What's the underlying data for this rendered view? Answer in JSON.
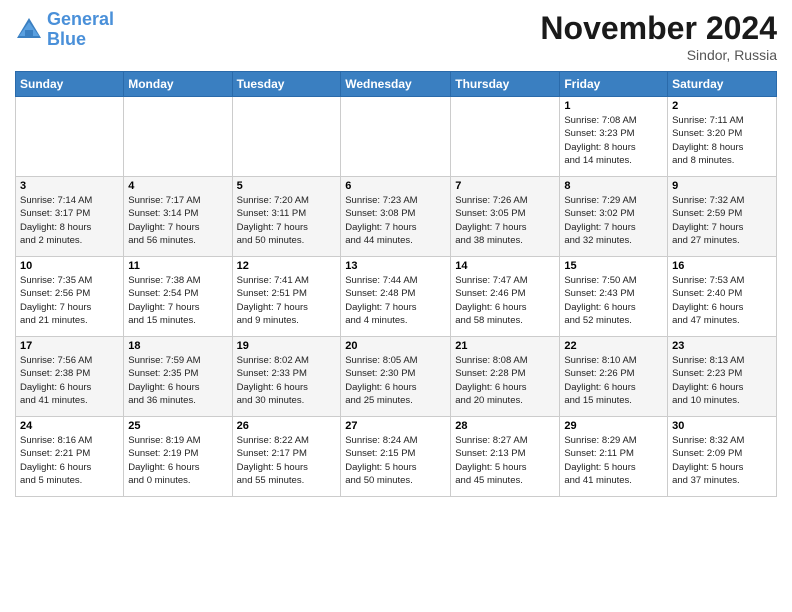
{
  "header": {
    "logo_line1": "General",
    "logo_line2": "Blue",
    "month": "November 2024",
    "location": "Sindor, Russia"
  },
  "days_of_week": [
    "Sunday",
    "Monday",
    "Tuesday",
    "Wednesday",
    "Thursday",
    "Friday",
    "Saturday"
  ],
  "weeks": [
    [
      {
        "day": "",
        "info": ""
      },
      {
        "day": "",
        "info": ""
      },
      {
        "day": "",
        "info": ""
      },
      {
        "day": "",
        "info": ""
      },
      {
        "day": "",
        "info": ""
      },
      {
        "day": "1",
        "info": "Sunrise: 7:08 AM\nSunset: 3:23 PM\nDaylight: 8 hours\nand 14 minutes."
      },
      {
        "day": "2",
        "info": "Sunrise: 7:11 AM\nSunset: 3:20 PM\nDaylight: 8 hours\nand 8 minutes."
      }
    ],
    [
      {
        "day": "3",
        "info": "Sunrise: 7:14 AM\nSunset: 3:17 PM\nDaylight: 8 hours\nand 2 minutes."
      },
      {
        "day": "4",
        "info": "Sunrise: 7:17 AM\nSunset: 3:14 PM\nDaylight: 7 hours\nand 56 minutes."
      },
      {
        "day": "5",
        "info": "Sunrise: 7:20 AM\nSunset: 3:11 PM\nDaylight: 7 hours\nand 50 minutes."
      },
      {
        "day": "6",
        "info": "Sunrise: 7:23 AM\nSunset: 3:08 PM\nDaylight: 7 hours\nand 44 minutes."
      },
      {
        "day": "7",
        "info": "Sunrise: 7:26 AM\nSunset: 3:05 PM\nDaylight: 7 hours\nand 38 minutes."
      },
      {
        "day": "8",
        "info": "Sunrise: 7:29 AM\nSunset: 3:02 PM\nDaylight: 7 hours\nand 32 minutes."
      },
      {
        "day": "9",
        "info": "Sunrise: 7:32 AM\nSunset: 2:59 PM\nDaylight: 7 hours\nand 27 minutes."
      }
    ],
    [
      {
        "day": "10",
        "info": "Sunrise: 7:35 AM\nSunset: 2:56 PM\nDaylight: 7 hours\nand 21 minutes."
      },
      {
        "day": "11",
        "info": "Sunrise: 7:38 AM\nSunset: 2:54 PM\nDaylight: 7 hours\nand 15 minutes."
      },
      {
        "day": "12",
        "info": "Sunrise: 7:41 AM\nSunset: 2:51 PM\nDaylight: 7 hours\nand 9 minutes."
      },
      {
        "day": "13",
        "info": "Sunrise: 7:44 AM\nSunset: 2:48 PM\nDaylight: 7 hours\nand 4 minutes."
      },
      {
        "day": "14",
        "info": "Sunrise: 7:47 AM\nSunset: 2:46 PM\nDaylight: 6 hours\nand 58 minutes."
      },
      {
        "day": "15",
        "info": "Sunrise: 7:50 AM\nSunset: 2:43 PM\nDaylight: 6 hours\nand 52 minutes."
      },
      {
        "day": "16",
        "info": "Sunrise: 7:53 AM\nSunset: 2:40 PM\nDaylight: 6 hours\nand 47 minutes."
      }
    ],
    [
      {
        "day": "17",
        "info": "Sunrise: 7:56 AM\nSunset: 2:38 PM\nDaylight: 6 hours\nand 41 minutes."
      },
      {
        "day": "18",
        "info": "Sunrise: 7:59 AM\nSunset: 2:35 PM\nDaylight: 6 hours\nand 36 minutes."
      },
      {
        "day": "19",
        "info": "Sunrise: 8:02 AM\nSunset: 2:33 PM\nDaylight: 6 hours\nand 30 minutes."
      },
      {
        "day": "20",
        "info": "Sunrise: 8:05 AM\nSunset: 2:30 PM\nDaylight: 6 hours\nand 25 minutes."
      },
      {
        "day": "21",
        "info": "Sunrise: 8:08 AM\nSunset: 2:28 PM\nDaylight: 6 hours\nand 20 minutes."
      },
      {
        "day": "22",
        "info": "Sunrise: 8:10 AM\nSunset: 2:26 PM\nDaylight: 6 hours\nand 15 minutes."
      },
      {
        "day": "23",
        "info": "Sunrise: 8:13 AM\nSunset: 2:23 PM\nDaylight: 6 hours\nand 10 minutes."
      }
    ],
    [
      {
        "day": "24",
        "info": "Sunrise: 8:16 AM\nSunset: 2:21 PM\nDaylight: 6 hours\nand 5 minutes."
      },
      {
        "day": "25",
        "info": "Sunrise: 8:19 AM\nSunset: 2:19 PM\nDaylight: 6 hours\nand 0 minutes."
      },
      {
        "day": "26",
        "info": "Sunrise: 8:22 AM\nSunset: 2:17 PM\nDaylight: 5 hours\nand 55 minutes."
      },
      {
        "day": "27",
        "info": "Sunrise: 8:24 AM\nSunset: 2:15 PM\nDaylight: 5 hours\nand 50 minutes."
      },
      {
        "day": "28",
        "info": "Sunrise: 8:27 AM\nSunset: 2:13 PM\nDaylight: 5 hours\nand 45 minutes."
      },
      {
        "day": "29",
        "info": "Sunrise: 8:29 AM\nSunset: 2:11 PM\nDaylight: 5 hours\nand 41 minutes."
      },
      {
        "day": "30",
        "info": "Sunrise: 8:32 AM\nSunset: 2:09 PM\nDaylight: 5 hours\nand 37 minutes."
      }
    ]
  ]
}
